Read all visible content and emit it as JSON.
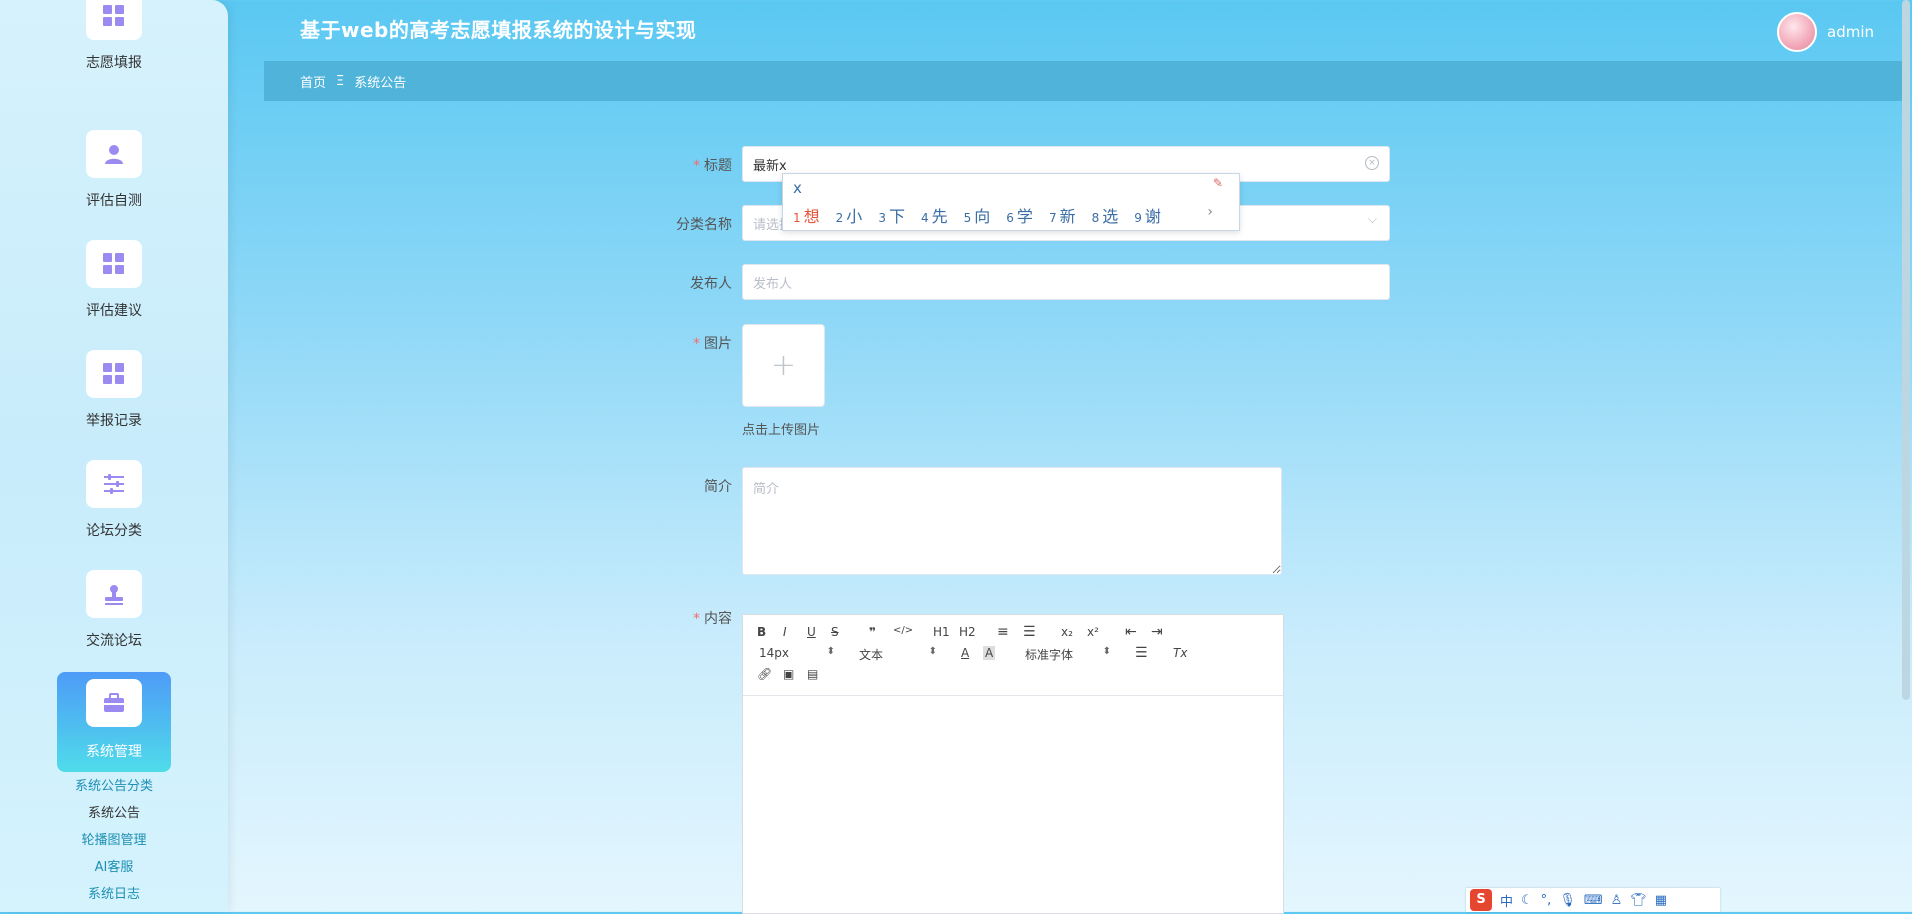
{
  "header": {
    "title": "基于web的高考志愿填报系统的设计与实现",
    "username": "admin"
  },
  "breadcrumb": {
    "home": "首页",
    "separator": "Ξ",
    "current": "系统公告"
  },
  "sidebar": {
    "items": [
      {
        "label": "志愿填报",
        "icon": "grid-icon"
      },
      {
        "label": "评估自测",
        "icon": "user-icon"
      },
      {
        "label": "评估建议",
        "icon": "grid-icon"
      },
      {
        "label": "举报记录",
        "icon": "grid-icon"
      },
      {
        "label": "论坛分类",
        "icon": "sliders-icon"
      },
      {
        "label": "交流论坛",
        "icon": "stamp-icon"
      },
      {
        "label": "系统管理",
        "icon": "briefcase-icon",
        "active": true
      }
    ],
    "submenu": [
      "系统公告分类",
      "系统公告",
      "轮播图管理",
      "AI客服",
      "系统日志"
    ]
  },
  "form": {
    "title_label": "标题",
    "title_value": "最新x",
    "category_label": "分类名称",
    "category_placeholder": "请选择",
    "publisher_label": "发布人",
    "publisher_placeholder": "发布人",
    "image_label": "图片",
    "upload_icon": "+",
    "upload_hint": "点击上传图片",
    "intro_label": "简介",
    "intro_placeholder": "简介",
    "content_label": "内容",
    "required_mark": "*"
  },
  "editor": {
    "font_size": "14px",
    "text_style": "文本",
    "font_family": "标准字体",
    "tools": [
      "B",
      "I",
      "U",
      "S",
      "❞",
      "</>",
      "H1",
      "H2",
      "≡",
      "☰",
      "x₂",
      "x²",
      "⇤",
      "⇥"
    ]
  },
  "ime": {
    "composition": "x",
    "candidates": [
      {
        "n": "1",
        "c": "想"
      },
      {
        "n": "2",
        "c": "小"
      },
      {
        "n": "3",
        "c": "下"
      },
      {
        "n": "4",
        "c": "先"
      },
      {
        "n": "5",
        "c": "向"
      },
      {
        "n": "6",
        "c": "学"
      },
      {
        "n": "7",
        "c": "新"
      },
      {
        "n": "8",
        "c": "选"
      },
      {
        "n": "9",
        "c": "谢"
      }
    ]
  },
  "tray": {
    "brand": "S",
    "mode": "中"
  },
  "colors": {
    "accent": "#4fb3da",
    "required": "#f56c6c",
    "active_menu_start": "#4e9bf7",
    "active_menu_end": "#4fdcea",
    "icon": "#9b8bf0"
  }
}
